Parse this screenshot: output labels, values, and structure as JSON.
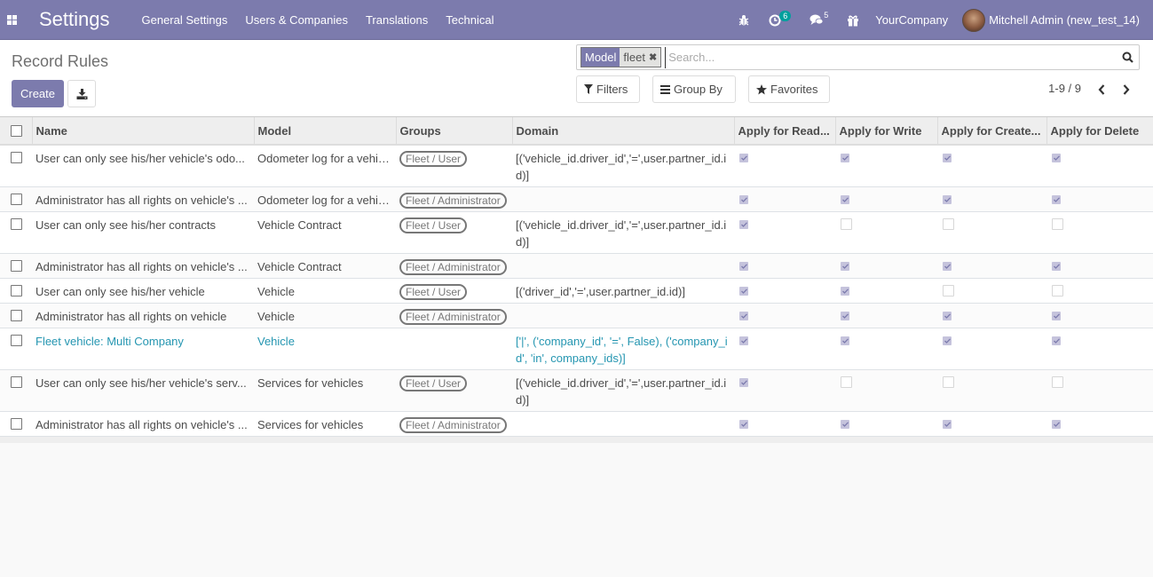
{
  "navbar": {
    "app_name": "Settings",
    "menu": [
      "General Settings",
      "Users & Companies",
      "Translations",
      "Technical"
    ],
    "icons": {
      "apps": "apps-grid-icon",
      "debug": "bug-icon",
      "activity": "clock-icon",
      "messages": "chat-icon",
      "gift": "gift-icon"
    },
    "activity_count": "6",
    "messages_count": "5",
    "company": "YourCompany",
    "user": "Mitchell Admin (new_test_14)"
  },
  "control_panel": {
    "title": "Record Rules",
    "create_label": "Create",
    "search": {
      "facet_label": "Model",
      "facet_value": "fleet",
      "placeholder": "Search...",
      "value": ""
    },
    "filters_label": "Filters",
    "groupby_label": "Group By",
    "favorites_label": "Favorites",
    "pager": "1-9 / 9"
  },
  "colors": {
    "brand": "#7c7bad",
    "teal_badge": "#00a09d",
    "link_row": "#2596b1"
  },
  "table": {
    "columns": [
      "Name",
      "Model",
      "Groups",
      "Domain",
      "Apply for Read...",
      "Apply for Write",
      "Apply for Create...",
      "Apply for Delete"
    ],
    "rows": [
      {
        "name": "User can only see his/her vehicle's odo...",
        "model": "Odometer log for a vehicle",
        "group": "Fleet / User",
        "domain": "[('vehicle_id.driver_id','=',user.partner_id.id)]",
        "read": true,
        "write": true,
        "create": true,
        "delete": true
      },
      {
        "name": "Administrator has all rights on vehicle's ...",
        "model": "Odometer log for a vehicle",
        "group": "Fleet / Administrator",
        "domain": "",
        "read": true,
        "write": true,
        "create": true,
        "delete": true
      },
      {
        "name": "User can only see his/her contracts",
        "model": "Vehicle Contract",
        "group": "Fleet / User",
        "domain": "[('vehicle_id.driver_id','=',user.partner_id.id)]",
        "read": true,
        "write": false,
        "create": false,
        "delete": false
      },
      {
        "name": "Administrator has all rights on vehicle's ...",
        "model": "Vehicle Contract",
        "group": "Fleet / Administrator",
        "domain": "",
        "read": true,
        "write": true,
        "create": true,
        "delete": true
      },
      {
        "name": "User can only see his/her vehicle",
        "model": "Vehicle",
        "group": "Fleet / User",
        "domain": "[('driver_id','=',user.partner_id.id)]",
        "read": true,
        "write": true,
        "create": false,
        "delete": false
      },
      {
        "name": "Administrator has all rights on vehicle",
        "model": "Vehicle",
        "group": "Fleet / Administrator",
        "domain": "",
        "read": true,
        "write": true,
        "create": true,
        "delete": true
      },
      {
        "name": "Fleet vehicle: Multi Company",
        "model": "Vehicle",
        "group": "",
        "domain": "['|', ('company_id', '=', False), ('company_id', 'in', company_ids)]",
        "read": true,
        "write": true,
        "create": true,
        "delete": true,
        "highlight": true
      },
      {
        "name": "User can only see his/her vehicle's serv...",
        "model": "Services for vehicles",
        "group": "Fleet / User",
        "domain": "[('vehicle_id.driver_id','=',user.partner_id.id)]",
        "read": true,
        "write": false,
        "create": false,
        "delete": false
      },
      {
        "name": "Administrator has all rights on vehicle's ...",
        "model": "Services for vehicles",
        "group": "Fleet / Administrator",
        "domain": "",
        "read": true,
        "write": true,
        "create": true,
        "delete": true
      }
    ]
  }
}
